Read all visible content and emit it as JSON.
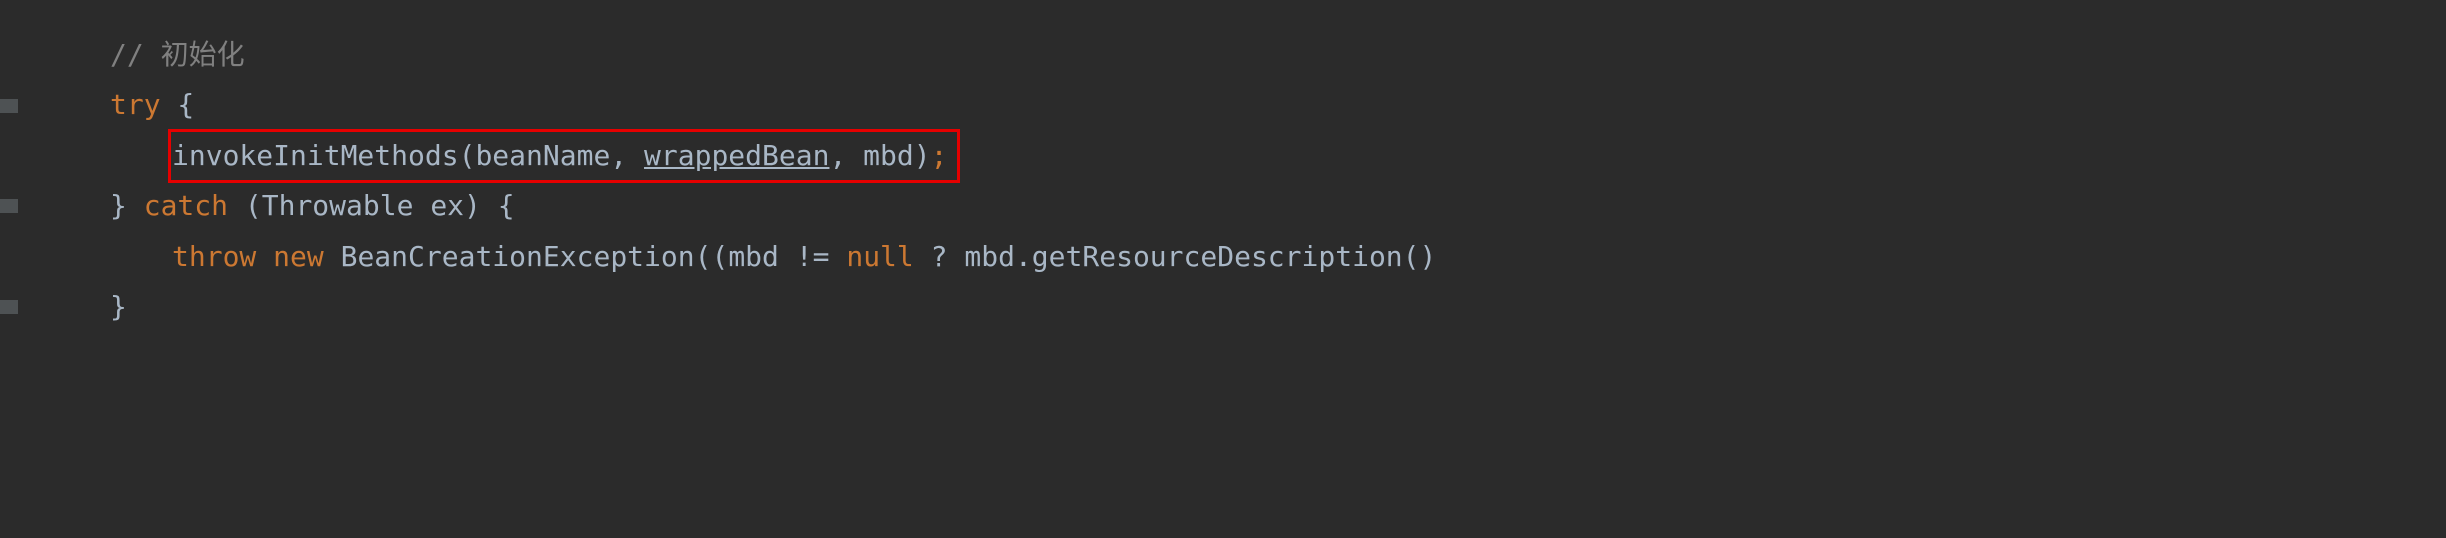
{
  "code": {
    "line1": {
      "comment": "// 初始化"
    },
    "line2": {
      "keyword_try": "try",
      "brace_open": " {"
    },
    "line3": {
      "method": "invokeInitMethods",
      "paren_open": "(",
      "arg1": "beanName",
      "comma1": ", ",
      "arg2": "wrappedBean",
      "comma2": ", ",
      "arg3": "mbd",
      "paren_close": ")",
      "semicolon": ";"
    },
    "line4": {
      "brace_close": "} ",
      "keyword_catch": "catch",
      "paren_open": " (",
      "type": "Throwable ",
      "var": "ex",
      "paren_close": ") {"
    },
    "line5": {
      "keyword_throw": "throw",
      "space1": " ",
      "keyword_new": "new",
      "space2": " ",
      "class": "BeanCreationException",
      "paren_open": "((",
      "var1": "mbd ",
      "op_neq": "!= ",
      "keyword_null": "null",
      "op_tern": " ? ",
      "var2": "mbd",
      "dot": ".",
      "method2": "getResourceDescription",
      "paren_close": "()"
    },
    "line6": {
      "brace_close": "}"
    }
  }
}
